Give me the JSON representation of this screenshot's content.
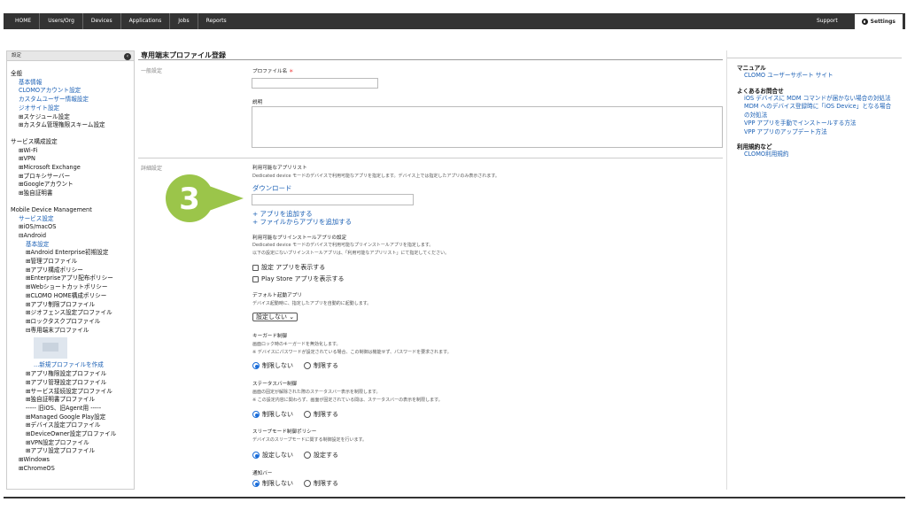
{
  "nav": {
    "items": [
      "HOME",
      "Users/Org",
      "Devices",
      "Applications",
      "Jobs",
      "Reports"
    ],
    "support": "Support",
    "settings": "Settings"
  },
  "sidebar": {
    "header": "設定",
    "collapse_glyph": "‹",
    "lines": [
      {
        "text": "全般",
        "kind": "sec",
        "indent": 0
      },
      {
        "text": "基本情報",
        "kind": "lnk",
        "indent": 1
      },
      {
        "text": "CLOMOアカウント設定",
        "kind": "lnk",
        "indent": 1
      },
      {
        "text": "カスタムユーザー情報設定",
        "kind": "lnk",
        "indent": 1
      },
      {
        "text": "ジオサイト設定",
        "kind": "lnk",
        "indent": 1
      },
      {
        "text": "⊞スケジュール設定",
        "kind": "sec",
        "indent": 1
      },
      {
        "text": "⊞カスタム管理権限スキーム設定",
        "kind": "sec",
        "indent": 1
      },
      {
        "text": "",
        "kind": "gap",
        "indent": 0
      },
      {
        "text": "サービス構成設定",
        "kind": "sec",
        "indent": 0
      },
      {
        "text": "⊞Wi-Fi",
        "kind": "sec",
        "indent": 1
      },
      {
        "text": "⊞VPN",
        "kind": "sec",
        "indent": 1
      },
      {
        "text": "⊞Microsoft Exchange",
        "kind": "sec",
        "indent": 1
      },
      {
        "text": "⊞プロキシサーバー",
        "kind": "sec",
        "indent": 1
      },
      {
        "text": "⊞Googleアカウント",
        "kind": "sec",
        "indent": 1
      },
      {
        "text": "⊞独自証明書",
        "kind": "sec",
        "indent": 1
      },
      {
        "text": "",
        "kind": "gap",
        "indent": 0
      },
      {
        "text": "Mobile Device Management",
        "kind": "sec",
        "indent": 0
      },
      {
        "text": "サービス設定",
        "kind": "lnk",
        "indent": 1
      },
      {
        "text": "⊞iOS/macOS",
        "kind": "sec",
        "indent": 1
      },
      {
        "text": "⊟Android",
        "kind": "sec",
        "indent": 1
      },
      {
        "text": "基本設定",
        "kind": "lnk",
        "indent": 2
      },
      {
        "text": "⊞Android Enterprise初期設定",
        "kind": "sec",
        "indent": 2
      },
      {
        "text": "⊞管理プロファイル",
        "kind": "sec",
        "indent": 2
      },
      {
        "text": "⊞アプリ構成ポリシー",
        "kind": "sec",
        "indent": 2
      },
      {
        "text": "⊞Enterpriseアプリ配布ポリシー",
        "kind": "sec",
        "indent": 2
      },
      {
        "text": "⊞Webショートカットポリシー",
        "kind": "sec",
        "indent": 2
      },
      {
        "text": "⊞CLOMO HOME構成ポリシー",
        "kind": "sec",
        "indent": 2
      },
      {
        "text": "⊞アプリ制限プロファイル",
        "kind": "sec",
        "indent": 2
      },
      {
        "text": "⊞ジオフェンス設定プロファイル",
        "kind": "sec",
        "indent": 2
      },
      {
        "text": "⊞ロックタスクプロファイル",
        "kind": "sec",
        "indent": 2
      },
      {
        "text": "⊟専用端末プロファイル",
        "kind": "sec",
        "indent": 2
      },
      {
        "text": "",
        "kind": "blur",
        "indent": 0
      },
      {
        "text": "...新規プロファイルを作成",
        "kind": "lnk",
        "indent": 3
      },
      {
        "text": "⊞アプリ権限設定プロファイル",
        "kind": "sec",
        "indent": 2
      },
      {
        "text": "⊞アプリ管理設定プロファイル",
        "kind": "sec",
        "indent": 2
      },
      {
        "text": "⊞サービス接続設定プロファイル",
        "kind": "sec",
        "indent": 2
      },
      {
        "text": "⊞独自証明書プロファイル",
        "kind": "sec",
        "indent": 2
      },
      {
        "text": "----- 旧iOS、旧Agent用 -----",
        "kind": "sec",
        "indent": 2
      },
      {
        "text": "⊞Managed Google Play設定",
        "kind": "sec",
        "indent": 2
      },
      {
        "text": "⊞デバイス設定プロファイル",
        "kind": "sec",
        "indent": 2
      },
      {
        "text": "⊞DeviceOwner設定プロファイル",
        "kind": "sec",
        "indent": 2
      },
      {
        "text": "⊞VPN設定プロファイル",
        "kind": "sec",
        "indent": 2
      },
      {
        "text": "⊞アプリ設定プロファイル",
        "kind": "sec",
        "indent": 2
      },
      {
        "text": "⊞Windows",
        "kind": "sec",
        "indent": 1
      },
      {
        "text": "⊞ChromeOS",
        "kind": "sec",
        "indent": 1
      }
    ]
  },
  "main": {
    "title": "専用端末プロファイル登録",
    "general_label": "一般設定",
    "profile_name_label": "プロファイル名",
    "required_mark": "＊",
    "description_label": "説明",
    "detail_label": "詳細設定",
    "apps_label": "利用可能なアプリリスト",
    "apps_desc": "Dedicated device モードのデバイスで利用可能なアプリを指定します。デバイス上では指定したアプリのみ表示されます。",
    "download_link": "ダウンロード",
    "add_app": "+ アプリを追加する",
    "add_app_file": "+ ファイルからアプリを追加する",
    "preinstall_label": "利用可能なプリインストールアプリの設定",
    "preinstall_desc1": "Dedicated device モードのデバイスで利用可能なプリインストールアプリを指定します。",
    "preinstall_desc2": "以下の設定にないプリインストールアプリは、「利用可能なアプリリスト」にて指定してください。",
    "chk_settings": "設定 アプリを表示する",
    "chk_playstore": "Play Store アプリを表示する",
    "default_launch_label": "デフォルト起動アプリ",
    "default_launch_desc": "デバイス起動時に、指定したアプリを自動的に起動します。",
    "default_launch_value": "設定しない",
    "keyguard_label": "キーガード制御",
    "keyguard_desc1": "画面ロック時のキーガードを無効化します。",
    "keyguard_desc2": "※ デバイスにパスワードが設定されている場合、この制御は機能せず、パスワードを要求されます。",
    "statusbar_label": "ステータスバー制御",
    "statusbar_desc1": "画面の固定が解除された際のステータスバー表示を制限します。",
    "statusbar_desc2": "※ この設定内容に関わらず、画面が固定されている間は、ステータスバーの表示を制限します。",
    "sleep_label": "スリープモード制御ポリシー",
    "sleep_desc": "デバイスのスリープモードに関する制御設定を行います。",
    "notify_label": "通知バー",
    "opt_norestrict": "制限しない",
    "opt_restrict": "制限する",
    "opt_noset": "設定しない",
    "opt_set": "設定する",
    "callout_number": "3"
  },
  "right": {
    "manual_title": "マニュアル",
    "manual_link": "CLOMO ユーザーサポート サイト",
    "faq_title": "よくあるお問合せ",
    "faq1": "iOS デバイスに MDM コマンドが届かない場合の対処法",
    "faq2": "MDM へのデバイス登録時に「iOS Device」となる場合の対処法",
    "faq3": "VPP アプリを手動でインストールする方法",
    "faq4": "VPP アプリのアップデート方法",
    "terms_title": "利用規約など",
    "terms_link": "CLOMO利用規約"
  },
  "colors": {
    "link": "#1a5fb4",
    "callout_green": "#9bc54a",
    "radio_blue": "#1a6dd9"
  }
}
